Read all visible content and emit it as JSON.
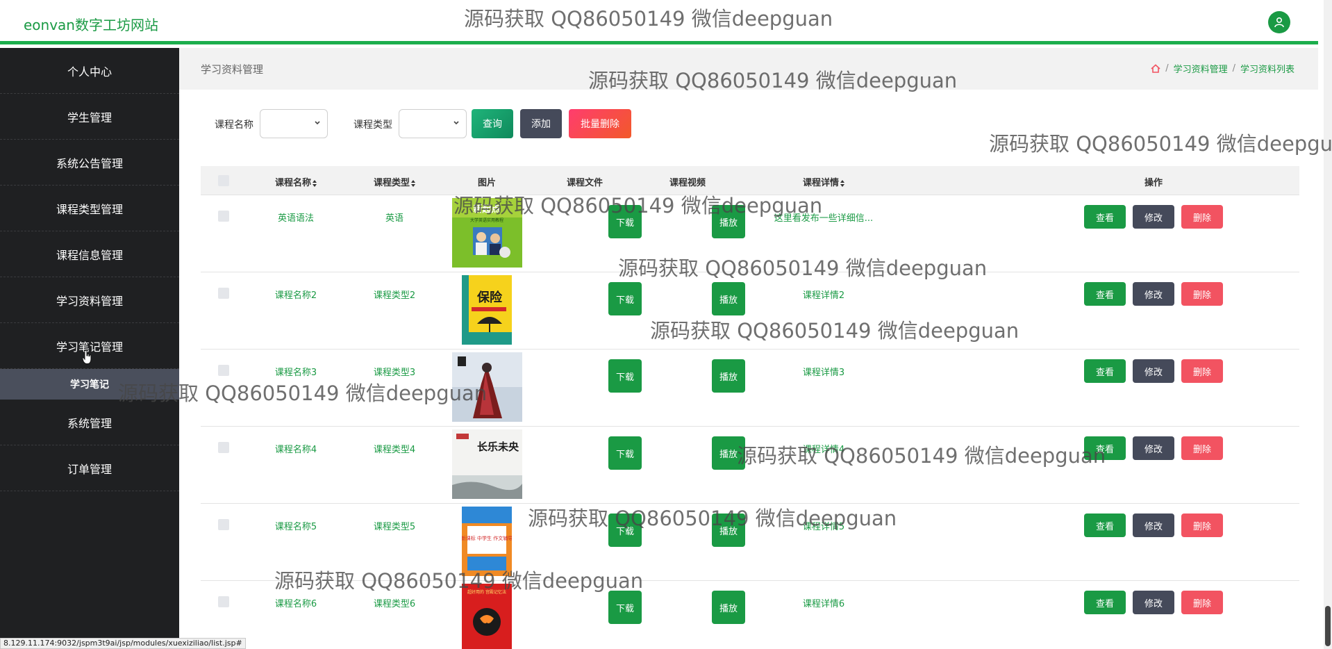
{
  "header": {
    "brand": "eonvan数字工坊网站",
    "avatar_icon": "user-icon"
  },
  "sidebar": {
    "items": [
      {
        "label": "个人中心"
      },
      {
        "label": "学生管理"
      },
      {
        "label": "系统公告管理"
      },
      {
        "label": "课程类型管理"
      },
      {
        "label": "课程信息管理"
      },
      {
        "label": "学习资料管理"
      },
      {
        "label": "学习笔记管理"
      }
    ],
    "sub_item": "学习笔记",
    "items_after": [
      {
        "label": "系统管理"
      },
      {
        "label": "订单管理"
      }
    ]
  },
  "page": {
    "title": "学习资料管理",
    "breadcrumb": [
      "学习资料管理",
      "学习资料列表"
    ]
  },
  "search": {
    "label1": "课程名称",
    "label2": "课程类型",
    "query_btn": "查询",
    "add_btn": "添加",
    "batch_delete_btn": "批量删除"
  },
  "table": {
    "headers": [
      "课程名称",
      "课程类型",
      "图片",
      "课程文件",
      "课程视频",
      "课程详情",
      "操作"
    ],
    "rows": [
      {
        "name": "英语语法",
        "type": "英语",
        "detail": "这里看发布一些详细信..."
      },
      {
        "name": "课程名称2",
        "type": "课程类型2",
        "detail": "课程详情2"
      },
      {
        "name": "课程名称3",
        "type": "课程类型3",
        "detail": "课程详情3"
      },
      {
        "name": "课程名称4",
        "type": "课程类型4",
        "detail": "课程详情4"
      },
      {
        "name": "课程名称5",
        "type": "课程类型5",
        "detail": "课程详情5"
      },
      {
        "name": "课程名称6",
        "type": "课程类型6",
        "detail": "课程详情6"
      }
    ],
    "download_label": "下载",
    "play_label": "播放",
    "view_label": "查看",
    "edit_label": "修改",
    "delete_label": "删除"
  },
  "book_covers": {
    "row1": {
      "text": "新起点",
      "sub": "大学英语实用教程"
    },
    "row2": {
      "text": "保险"
    },
    "row4": {
      "text": "长乐未央"
    },
    "row5": {
      "text": "新课标 中学生 作文辅导"
    },
    "row6": {
      "text": "超好用的 宫殿记忆法"
    }
  },
  "statusbar": {
    "url": "8.129.11.174:9032/jspm3t9ai/jsp/modules/xuexiziliao/list.jsp#"
  },
  "watermark": {
    "text": "源码获取 QQ86050149 微信deepguan"
  },
  "colors": {
    "primary": "#1a9a44",
    "sidebar": "#1f2022",
    "edit": "#454a5a",
    "danger": "#f25361",
    "batch_delete": "#f74a3a"
  }
}
